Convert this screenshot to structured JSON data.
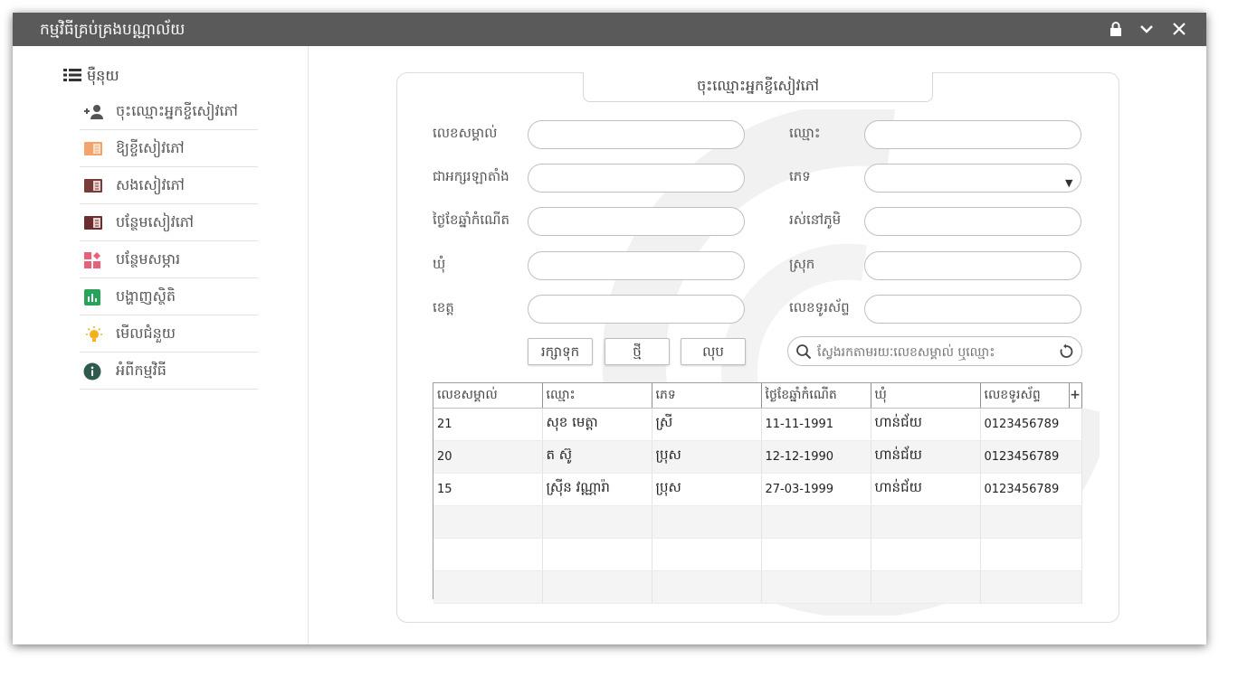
{
  "window": {
    "title": "កម្មវិធីគ្រប់គ្រងបណ្ណាល័យ"
  },
  "sidebar": {
    "header": "ម៉ឺនុយ",
    "items": [
      {
        "label": "ចុះឈ្មោះអ្នកខ្ចីសៀវភៅ",
        "icon": "add-user-icon"
      },
      {
        "label": "ឱ្យខ្ចីសៀវភៅ",
        "icon": "open-book-icon"
      },
      {
        "label": "សងសៀវភៅ",
        "icon": "book-return-icon"
      },
      {
        "label": "បន្ថែមសៀវភៅ",
        "icon": "add-book-icon"
      },
      {
        "label": "បន្ថែមសម្ភារ",
        "icon": "add-material-icon"
      },
      {
        "label": "បង្ហាញស្ថិតិ",
        "icon": "statistics-icon"
      },
      {
        "label": "មើលជំនួយ",
        "icon": "lightbulb-icon"
      },
      {
        "label": "អំពីកម្មវិធី",
        "icon": "info-icon"
      }
    ]
  },
  "form": {
    "tab_title": "ចុះឈ្មោះអ្នកខ្ចីសៀវភៅ",
    "labels": {
      "id": "លេខសម្គាល់",
      "latin_name": "ជាអក្សរឡាតាំង",
      "dob": "ថ្ងៃខែឆ្នាំកំណើត",
      "commune": "ឃុំ",
      "province": "ខេត្ត",
      "name": "ឈ្មោះ",
      "gender": "ភេទ",
      "village": "រស់នៅភូមិ",
      "district": "ស្រុក",
      "phone": "លេខទូរស័ព្ទ"
    },
    "values": {
      "id": "",
      "latin_name": "",
      "dob": "",
      "commune": "",
      "province": "",
      "name": "",
      "gender": "",
      "village": "",
      "district": "",
      "phone": ""
    },
    "buttons": {
      "save": "រក្សាទុក",
      "new": "ថ្មី",
      "delete": "លុប"
    },
    "search_placeholder": "ស្វែងរកតាមរយៈលេខសម្គាល់ ឬឈ្មោះ"
  },
  "table": {
    "columns": [
      "លេខសម្គាល់",
      "ឈ្មោះ",
      "ភេទ",
      "ថ្ងៃខែឆ្នាំកំណើត",
      "ឃុំ",
      "លេខទូរស័ព្ទ"
    ],
    "add_column": "+",
    "rows": [
      [
        "21",
        "សុខ មេត្តា",
        "ស្រី",
        "11-11-1991",
        "ហាន់ជ័យ",
        "0123456789"
      ],
      [
        "20",
        "ត ស៊ូ",
        "ប្រុស",
        "12-12-1990",
        "ហាន់ជ័យ",
        "0123456789"
      ],
      [
        "15",
        "ស៊្រីន វណ្ណារ៉ា",
        "ប្រុស",
        "27-03-1999",
        "ហាន់ជ័យ",
        "0123456789"
      ],
      [
        "",
        "",
        "",
        "",
        "",
        ""
      ],
      [
        "",
        "",
        "",
        "",
        "",
        ""
      ],
      [
        "",
        "",
        "",
        "",
        "",
        ""
      ]
    ]
  },
  "colors": {
    "titlebar": "#5a5a5a",
    "add_user": "#555555",
    "open_book": "#f4a46a",
    "book_return": "#7a3b3b",
    "add_book": "#6b2d2d",
    "add_material": "#e8607a",
    "statistics": "#27a35a",
    "lightbulb": "#f2b21b",
    "info": "#2f5b4f"
  }
}
